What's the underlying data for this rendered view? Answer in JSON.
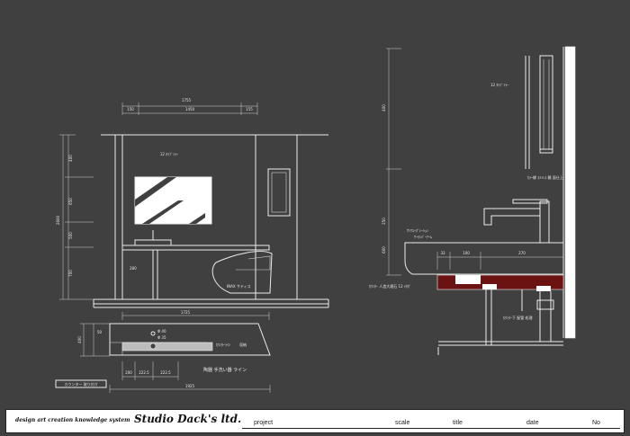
{
  "elevation": {
    "top_dim_total": "1755",
    "top_dim_parts": [
      "150",
      "1450",
      "155"
    ],
    "bottom_dim": "1725",
    "left_dim_total": "2600",
    "left_dims": [
      "400",
      "650",
      "500",
      "700"
    ],
    "label_mirror_top": "12 ﾀｲﾌﾞﾐﾗｰ",
    "label_toilet": "INAX サティス",
    "label_post": "280"
  },
  "plan": {
    "dim_depth": "400",
    "dim_small_a": "50",
    "dim_width_total": "1925",
    "dim_parts": [
      "200",
      "222.5",
      "222.5"
    ],
    "labels": {
      "hole1": "Φ 40",
      "hole2": "Φ 35",
      "counter_line": "ｶｳﾝﾀｰﾗｲﾝ",
      "basin": "収納",
      "sink_line": "陶器 手洗い器 ライン"
    },
    "tag": "カウンター 取り付け"
  },
  "section": {
    "left_dims": [
      "400",
      "250",
      "600"
    ],
    "label_mirror": "12 ﾀｲﾌﾞﾐﾗｰ",
    "label_frame": "ｶﾗｰ縁 ｽﾃﾝﾚｽ 鏡 面仕上",
    "label_faucet": "ｻﾝﾜｺｰﾎﾟﾚｰｼｮﾝ",
    "label_faucet2": "ｻｰﾓﾚﾊﾞｰｱｰﾑ",
    "counter_dims": [
      "33",
      "100",
      "270"
    ],
    "label_counter": "ｶｳﾝﾀｰ 人造大理石 12 ｲﾀｶﾞ",
    "label_pipe": "ｶｳﾝﾀｰ下 配管 処理"
  },
  "title_block": {
    "slogan": "design art creation knowledge system",
    "brand": "Studio Dack's ltd.",
    "project_label": "project",
    "scale_label": "scale",
    "title_label": "title",
    "date_label": "date",
    "no_label": "No"
  }
}
